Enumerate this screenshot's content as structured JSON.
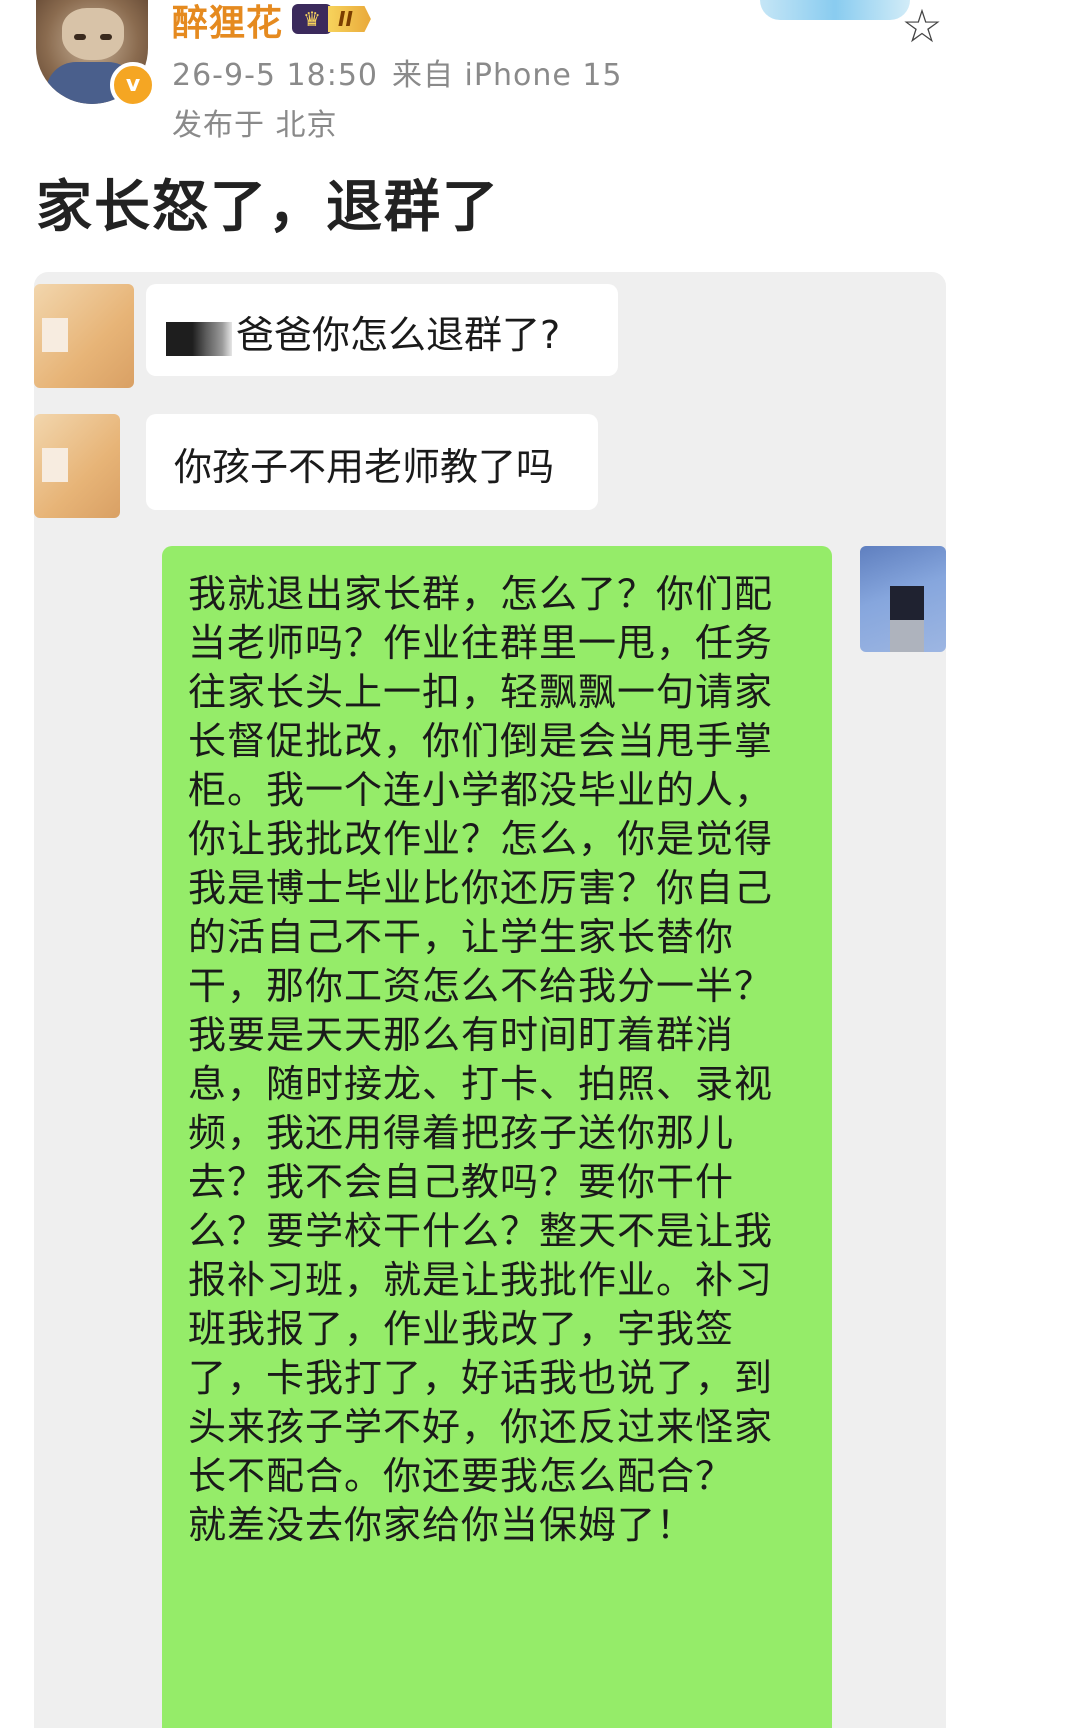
{
  "post": {
    "username": "醉狸花",
    "level_badge": "II",
    "verified_mark": "v",
    "time": "26-9-5 18:50",
    "source": "来自 iPhone 15",
    "location": "发布于 北京",
    "text": "家长怒了，退群了"
  },
  "icons": {
    "favorite": "star-outline-icon",
    "crown": "crown-icon"
  },
  "chat": {
    "messages": [
      {
        "side": "left",
        "text": "爸爸你怎么退群了?",
        "redacted_prefix": true
      },
      {
        "side": "left",
        "text": "你孩子不用老师教了吗"
      },
      {
        "side": "right",
        "text": "我就退出家长群，怎么了？你们配当老师吗？作业往群里一甩，任务往家长头上一扣，轻飘飘一句请家长督促批改，你们倒是会当甩手掌柜。我一个连小学都没毕业的人，你让我批改作业？怎么，你是觉得我是博士毕业比你还厉害？你自己的活自己不干，让学生家长替你干，那你工资怎么不给我分一半？我要是天天那么有时间盯着群消息，随时接龙、打卡、拍照、录视频，我还用得着把孩子送你那儿去？我不会自己教吗？要你干什么？要学校干什么？整天不是让我报补习班，就是让我批作业。补习班我报了，作业我改了，字我签了，卡我打了，好话我也说了，到头来孩子学不好，你还反过来怪家长不配合。你还要我怎么配合？\n就差没去你家给你当保姆了！"
      }
    ]
  },
  "colors": {
    "username": "#e58a1f",
    "meta": "#8a8a8a",
    "chat_bg": "#efefef",
    "bubble_self": "#95ec69",
    "bubble_other": "#ffffff"
  }
}
